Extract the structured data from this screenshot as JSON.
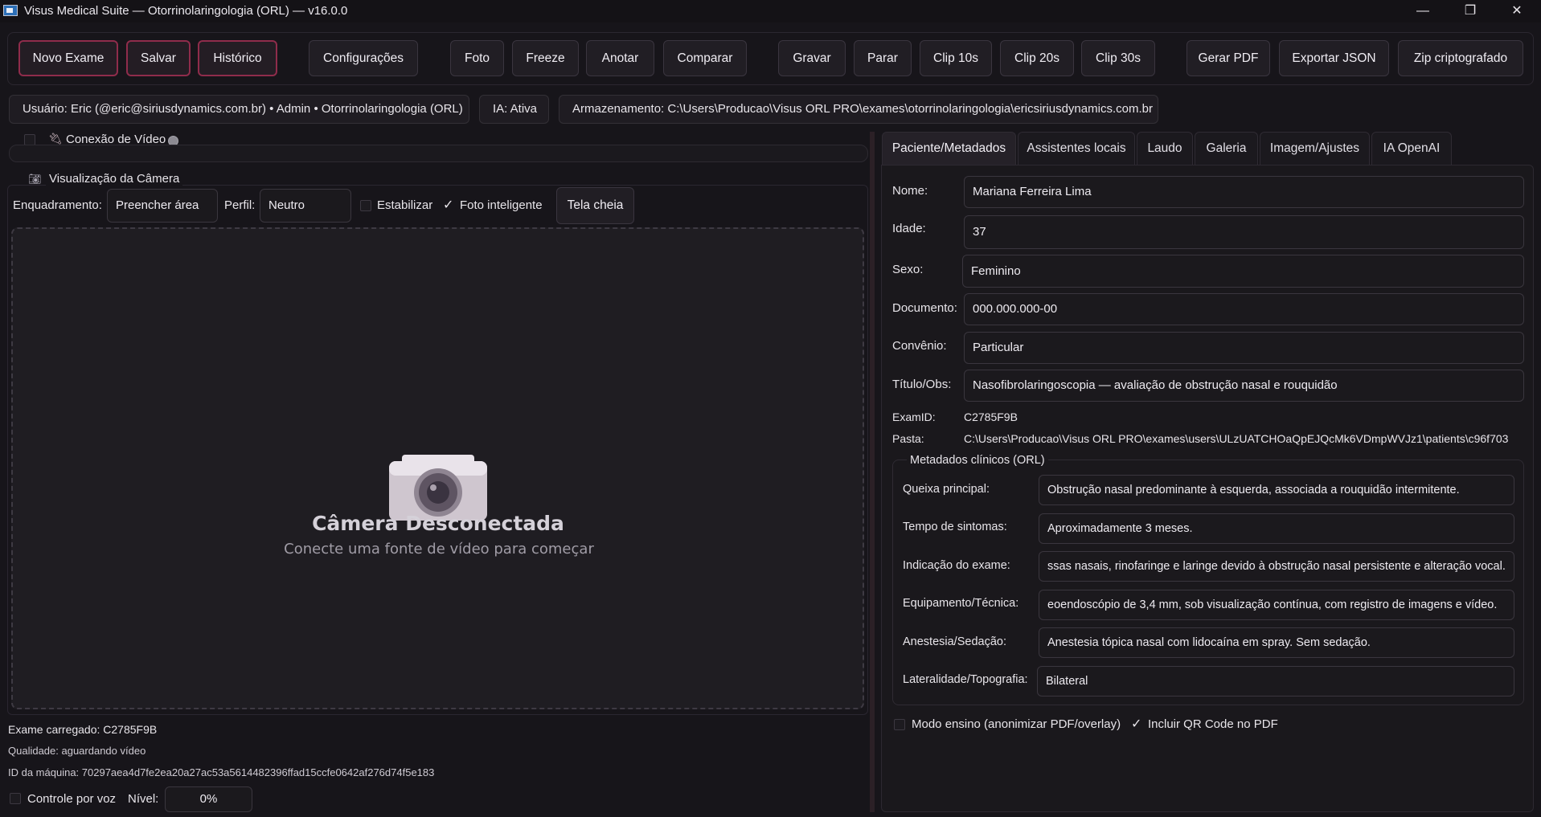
{
  "window": {
    "title": "Visus Medical Suite — Otorrinolaringologia (ORL) — v16.0.0",
    "minimize": "—",
    "maximize": "❐",
    "close": "✕"
  },
  "toolbar": {
    "novo_exame": "Novo Exame",
    "salvar": "Salvar",
    "historico": "Histórico",
    "configuracoes": "Configurações",
    "foto": "Foto",
    "freeze": "Freeze",
    "anotar": "Anotar",
    "comparar": "Comparar",
    "gravar": "Gravar",
    "parar": "Parar",
    "clip10": "Clip 10s",
    "clip20": "Clip 20s",
    "clip30": "Clip 30s",
    "gerar_pdf": "Gerar PDF",
    "exportar_json": "Exportar JSON",
    "zip": "Zip criptografado",
    "accent_color": "#8f2c4b"
  },
  "infobar": {
    "usuario": "Usuário: Eric (@eric@siriusdynamics.com.br) • Admin • Otorrinolaringologia (ORL)",
    "ia": "IA: Ativa",
    "armazenamento": "Armazenamento: C:\\Users\\Producao\\Visus ORL PRO\\exames\\otorrinolaringologia\\ericsiriusdynamics.com.br"
  },
  "video": {
    "conexao_label": "Conexão de Vídeo",
    "visualizacao_label": "Visualização da Câmera",
    "enquadramento_label": "Enquadramento:",
    "enquadramento_value": "Preencher área",
    "perfil_label": "Perfil:",
    "perfil_value": "Neutro",
    "estabilizar_label": "Estabilizar",
    "estabilizar_checked": false,
    "foto_inteligente_label": "Foto inteligente",
    "foto_inteligente_checked": true,
    "tela_cheia": "Tela cheia",
    "camera_status_title": "Câmera Desconectada",
    "camera_status_sub": "Conecte uma fonte de vídeo para começar"
  },
  "status": {
    "exame_carregado": "Exame carregado: C2785F9B",
    "qualidade": "Qualidade: aguardando vídeo",
    "id_maquina": "ID da máquina: 70297aea4d7fe2ea20a27ac53a5614482396ffad15ccfe0642af276d74f5e183",
    "controle_voz_label": "Controle por voz",
    "nivel_label": "Nível:",
    "nivel_value": "0%"
  },
  "tabs": [
    "Paciente/Metadados",
    "Assistentes locais",
    "Laudo",
    "Galeria",
    "Imagem/Ajustes",
    "IA OpenAI"
  ],
  "patient": {
    "nome_label": "Nome:",
    "nome": "Mariana Ferreira Lima",
    "idade_label": "Idade:",
    "idade": "37",
    "sexo_label": "Sexo:",
    "sexo": "Feminino",
    "documento_label": "Documento:",
    "documento": "000.000.000-00",
    "convenio_label": "Convênio:",
    "convenio": "Particular",
    "titulo_label": "Título/Obs:",
    "titulo": "Nasofibrolaringoscopia — avaliação de obstrução nasal e rouquidão",
    "examid_label": "ExamID:",
    "examid": "C2785F9B",
    "pasta_label": "Pasta:",
    "pasta": "C:\\Users\\Producao\\Visus ORL PRO\\exames\\users\\ULzUATCHOaQpEJQcMk6VDmpWVJz1\\patients\\c96f703"
  },
  "clinical": {
    "group_title": "Metadados clínicos (ORL)",
    "queixa_label": "Queixa principal:",
    "queixa": "Obstrução nasal predominante à esquerda, associada a rouquidão intermitente.",
    "tempo_label": "Tempo de sintomas:",
    "tempo": "Aproximadamente 3 meses.",
    "indicacao_label": "Indicação do exame:",
    "indicacao": "ssas nasais, rinofaringe e laringe devido à obstrução nasal persistente e alteração vocal.",
    "equipamento_label": "Equipamento/Técnica:",
    "equipamento": "eoendoscópio de 3,4 mm, sob visualização contínua, com registro de imagens e vídeo.",
    "anestesia_label": "Anestesia/Sedação:",
    "anestesia": "Anestesia tópica nasal com lidocaína em spray. Sem sedação.",
    "lateralidade_label": "Lateralidade/Topografia:",
    "lateralidade": "Bilateral"
  },
  "options": {
    "modo_ensino": "Modo ensino (anonimizar PDF/overlay)",
    "modo_ensino_checked": false,
    "qr_code": "Incluir QR Code no PDF",
    "qr_code_checked": true
  }
}
